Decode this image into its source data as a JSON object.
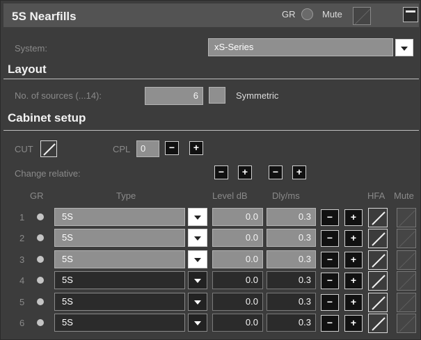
{
  "title": "5S Nearfills",
  "header": {
    "gr_label": "GR",
    "mute_label": "Mute"
  },
  "system": {
    "label": "System:",
    "value": "xS-Series"
  },
  "layout": {
    "heading": "Layout",
    "sources_label": "No. of sources (...14):",
    "sources_value": "6",
    "symmetric_label": "Symmetric"
  },
  "cabinet": {
    "heading": "Cabinet setup",
    "cut_label": "CUT",
    "cpl_label": "CPL",
    "cpl_value": "0",
    "change_relative_label": "Change relative:",
    "columns": {
      "gr": "GR",
      "type": "Type",
      "level": "Level dB",
      "dly": "Dly/ms",
      "hfa": "HFA",
      "mute": "Mute"
    },
    "rows": [
      {
        "num": "1",
        "type": "5S",
        "level": "0.0",
        "dly": "0.3",
        "enabled": false
      },
      {
        "num": "2",
        "type": "5S",
        "level": "0.0",
        "dly": "0.3",
        "enabled": false
      },
      {
        "num": "3",
        "type": "5S",
        "level": "0.0",
        "dly": "0.3",
        "enabled": false
      },
      {
        "num": "4",
        "type": "5S",
        "level": "0.0",
        "dly": "0.3",
        "enabled": true
      },
      {
        "num": "5",
        "type": "5S",
        "level": "0.0",
        "dly": "0.3",
        "enabled": true
      },
      {
        "num": "6",
        "type": "5S",
        "level": "0.0",
        "dly": "0.3",
        "enabled": true
      }
    ]
  },
  "glyphs": {
    "minus": "−",
    "plus": "+"
  }
}
